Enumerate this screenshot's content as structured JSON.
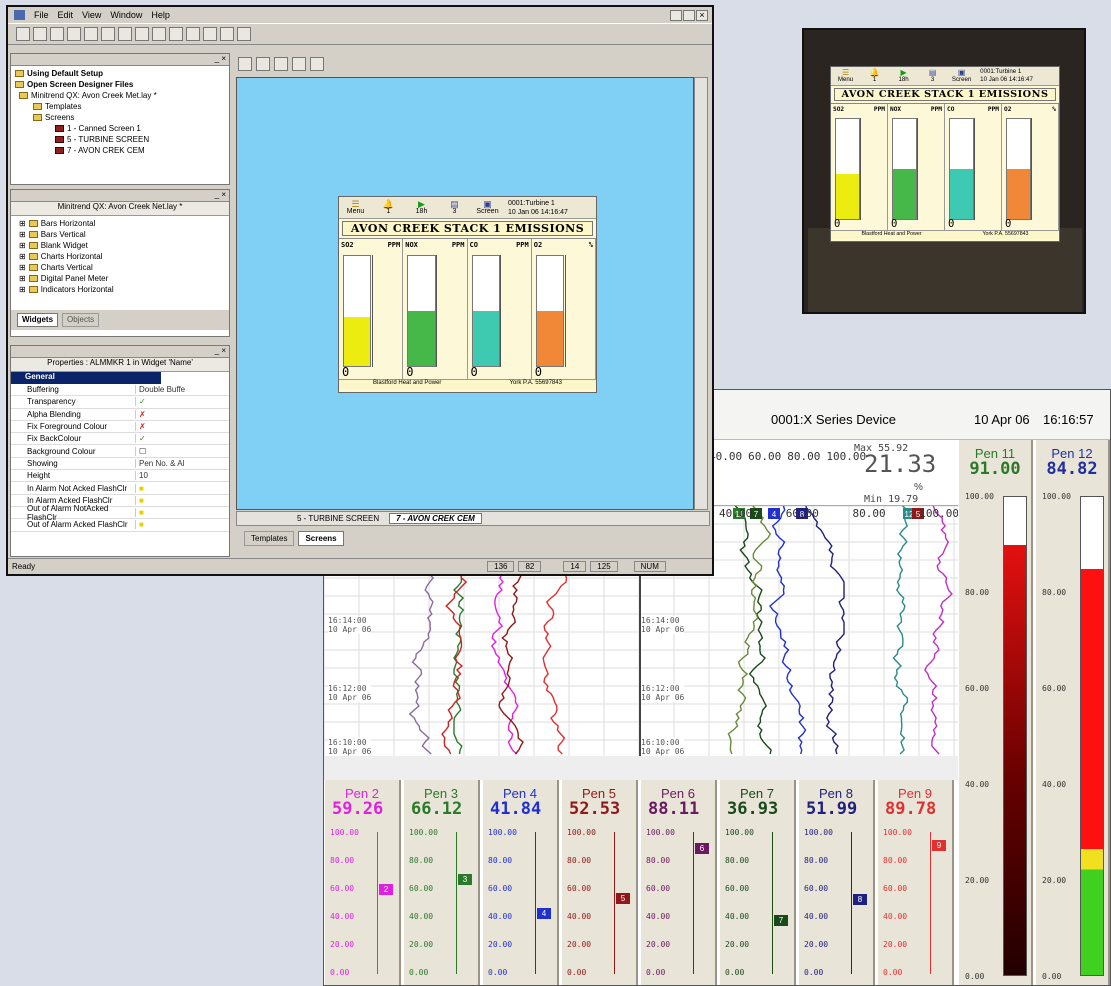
{
  "window": {
    "menu": [
      "File",
      "Edit",
      "View",
      "Window",
      "Help"
    ],
    "setup_panel": {
      "items": [
        "Using Default Setup",
        "Open Screen Designer Files",
        "Minitrend QX: Avon Creek Met.lay *",
        "Templates",
        "Screens",
        "1 - Canned Screen 1",
        "5 - TURBINE SCREEN",
        "7 - AVON CREK CEM"
      ]
    },
    "widget_panel": {
      "title": "Minitrend QX: Avon Creek Net.lay *",
      "items": [
        "Bars Horizontal",
        "Bars Vertical",
        "Blank Widget",
        "Charts Horizontal",
        "Charts Vertical",
        "Digital Panel Meter",
        "Indicators Horizontal"
      ],
      "tab_widgets": "Widgets",
      "tab_objects": "Objects"
    },
    "props_panel": {
      "title": "Properties : ALMMKR 1 in Widget 'Name'",
      "section": "General",
      "rows": [
        {
          "k": "Buffering",
          "v": "Double Buffe"
        },
        {
          "k": "Transparency",
          "v": "✓"
        },
        {
          "k": "Alpha Blending",
          "v": "✗"
        },
        {
          "k": "Fix Foreground Colour",
          "v": "✗"
        },
        {
          "k": "Fix BackColour",
          "v": "✓"
        },
        {
          "k": "Background Colour",
          "v": "☐"
        },
        {
          "k": "Showing",
          "v": "Pen No. & Al"
        },
        {
          "k": "Height",
          "v": "10"
        },
        {
          "k": "In Alarm Not Acked FlashClr",
          "v": "■"
        },
        {
          "k": "In Alarm Acked FlashClr",
          "v": "■"
        },
        {
          "k": "Out of Alarm NotAcked FlashClr",
          "v": "■"
        },
        {
          "k": "Out of Alarm Acked FlashClr",
          "v": "■"
        }
      ]
    },
    "canvas_tabs": [
      "5 - TURBINE SCREEN",
      "7 - AVON CREK CEM"
    ],
    "bottom_tabs": [
      "Templates",
      "Screens"
    ],
    "status": {
      "text": "Ready",
      "x": "136",
      "y": "82",
      "w": "14",
      "h": "125",
      "mode": "NUM"
    }
  },
  "stack_screen": {
    "buttons": [
      {
        "icon": "menu",
        "label": "Menu"
      },
      {
        "icon": "bell",
        "label": "1"
      },
      {
        "icon": "play",
        "label": "18h"
      },
      {
        "icon": "list",
        "label": "3"
      },
      {
        "icon": "screen",
        "label": "Screen"
      }
    ],
    "device": "0001:Turbine 1",
    "datetime": "10 Jan 06 14:16:47",
    "title": "AVON CREEK STACK 1 EMISSIONS",
    "bars": [
      {
        "name": "SO2",
        "unit": "PPM",
        "level": 0.45,
        "color": "#ecec10",
        "value": "0"
      },
      {
        "name": "NOX",
        "unit": "PPM",
        "level": 0.5,
        "color": "#46b84a",
        "value": "0"
      },
      {
        "name": "CO",
        "unit": "PPM",
        "level": 0.5,
        "color": "#3ecab0",
        "value": "0"
      },
      {
        "name": "O2",
        "unit": "%",
        "level": 0.5,
        "color": "#f08838",
        "value": "0"
      }
    ],
    "footer_left": "Blastford Heat and Power",
    "footer_right": "York P.A. 55697843"
  },
  "recorder": {
    "device": "0001:X Series Device",
    "date": "10 Apr 06",
    "time": "16:16:57",
    "dpm": {
      "max": "Max 55.92",
      "value": "21.33",
      "unit": "%",
      "min": "Min 19.79"
    },
    "scale_labels": [
      "40.00",
      "60.00",
      "80.00",
      "100.00"
    ],
    "scale2": [
      "40.00",
      "60.00",
      "80.00",
      "100.00"
    ],
    "time_marks": [
      {
        "t": "16:14:00",
        "d": "10 Apr 06"
      },
      {
        "t": "16:12:00",
        "d": "10 Apr 06"
      },
      {
        "t": "16:10:00",
        "d": "10 Apr 06"
      }
    ],
    "pens": [
      {
        "name": "Pen 2",
        "value": "59.26",
        "color": "#e020e0",
        "level": 0.59,
        "tag": "2"
      },
      {
        "name": "Pen 3",
        "value": "66.12",
        "color": "#2a7a2a",
        "level": 0.66,
        "tag": "3"
      },
      {
        "name": "Pen 4",
        "value": "41.84",
        "color": "#2030d0",
        "level": 0.42,
        "tag": "4"
      },
      {
        "name": "Pen 5",
        "value": "52.53",
        "color": "#901818",
        "level": 0.53,
        "tag": "5"
      },
      {
        "name": "Pen 6",
        "value": "88.11",
        "color": "#6a1a60",
        "level": 0.88,
        "tag": "6"
      },
      {
        "name": "Pen 7",
        "value": "36.93",
        "color": "#1a4a1a",
        "level": 0.37,
        "tag": "7"
      },
      {
        "name": "Pen 8",
        "value": "51.99",
        "color": "#202080",
        "level": 0.52,
        "tag": "8"
      },
      {
        "name": "Pen 9",
        "value": "89.78",
        "color": "#e03030",
        "level": 0.9,
        "tag": "9"
      }
    ],
    "pen_scale": [
      "100.00",
      "80.00",
      "60.00",
      "40.00",
      "20.00",
      "0.00"
    ],
    "big": [
      {
        "name": "Pen 11",
        "value": "91.00",
        "color": "#2a7a2a",
        "level": 0.9
      },
      {
        "name": "Pen 12",
        "value": "84.82",
        "color": "#2030a0",
        "level": 0.85
      }
    ],
    "big_scale": [
      "100.00",
      "80.00",
      "60.00",
      "40.00",
      "20.00",
      "0.00"
    ],
    "tags_top": [
      "11",
      "7",
      "4",
      "8",
      "12",
      "5"
    ]
  }
}
